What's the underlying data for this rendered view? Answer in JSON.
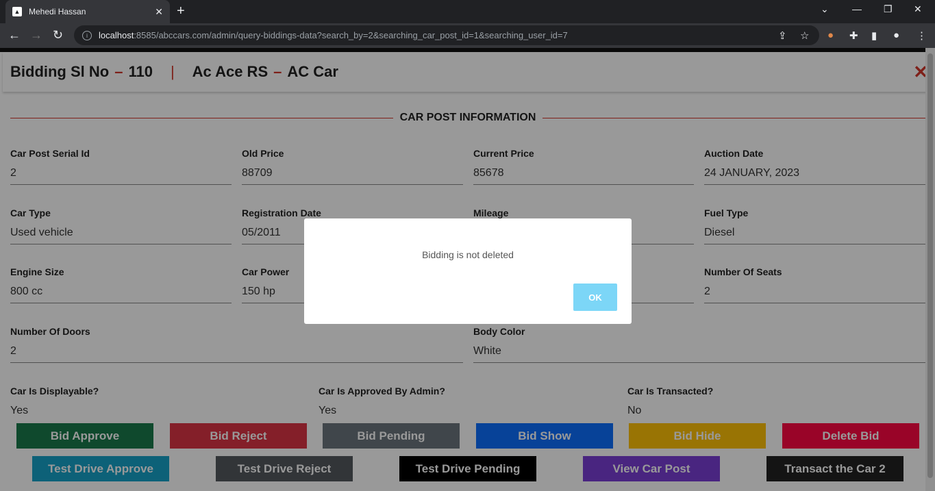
{
  "browser": {
    "tab_title": "Mehedi Hassan",
    "url_host": "localhost",
    "url_rest": ":8585/abccars.com/admin/query-biddings-data?search_by=2&searching_car_post_id=1&searching_user_id=7"
  },
  "header": {
    "bid_label": "Bidding Sl No",
    "bid_no": "110",
    "car_model": "Ac Ace RS",
    "car_name": "AC Car"
  },
  "section_title": "CAR POST INFORMATION",
  "fields": [
    {
      "label": "Car Post Serial Id",
      "value": "2"
    },
    {
      "label": "Old Price",
      "value": "88709"
    },
    {
      "label": "Current Price",
      "value": "85678"
    },
    {
      "label": "Auction Date",
      "value": "24 JANUARY, 2023"
    },
    {
      "label": "Car Type",
      "value": "Used vehicle"
    },
    {
      "label": "Registration Date",
      "value": "05/2011"
    },
    {
      "label": "Mileage",
      "value": ""
    },
    {
      "label": "Fuel Type",
      "value": "Diesel"
    },
    {
      "label": "Engine Size",
      "value": "800 cc"
    },
    {
      "label": "Car Power",
      "value": "150 hp"
    },
    {
      "label": "",
      "value": ""
    },
    {
      "label": "Number Of Seats",
      "value": "2"
    },
    {
      "label": "Number Of Doors",
      "value": "2"
    },
    {
      "label": "Body Color",
      "value": "White"
    },
    {
      "label": "Car Is Displayable?",
      "value": "Yes"
    },
    {
      "label": "Car Is Approved By Admin?",
      "value": "Yes"
    },
    {
      "label": "Car Is Transacted?",
      "value": "No"
    }
  ],
  "buttons": [
    {
      "label": "Bid Approve",
      "color": "#1a7a4c"
    },
    {
      "label": "Bid Reject",
      "color": "#dc3545"
    },
    {
      "label": "Bid Pending",
      "color": "#6c757d"
    },
    {
      "label": "Bid Show",
      "color": "#0d6efd"
    },
    {
      "label": "Bid Hide",
      "color": "#ffc107"
    },
    {
      "label": "Delete Bid",
      "color": "#ff0844"
    },
    {
      "label": "Test Drive Approve",
      "color": "#17a2c8"
    },
    {
      "label": "Test Drive Reject",
      "color": "#54595e"
    },
    {
      "label": "Test Drive Pending",
      "color": "#000000"
    },
    {
      "label": "View Car Post",
      "color": "#7b3fd6"
    },
    {
      "label": "Transact the Car 2",
      "color": "#222222"
    }
  ],
  "dialog": {
    "message": "Bidding is not deleted",
    "ok_label": "OK"
  }
}
